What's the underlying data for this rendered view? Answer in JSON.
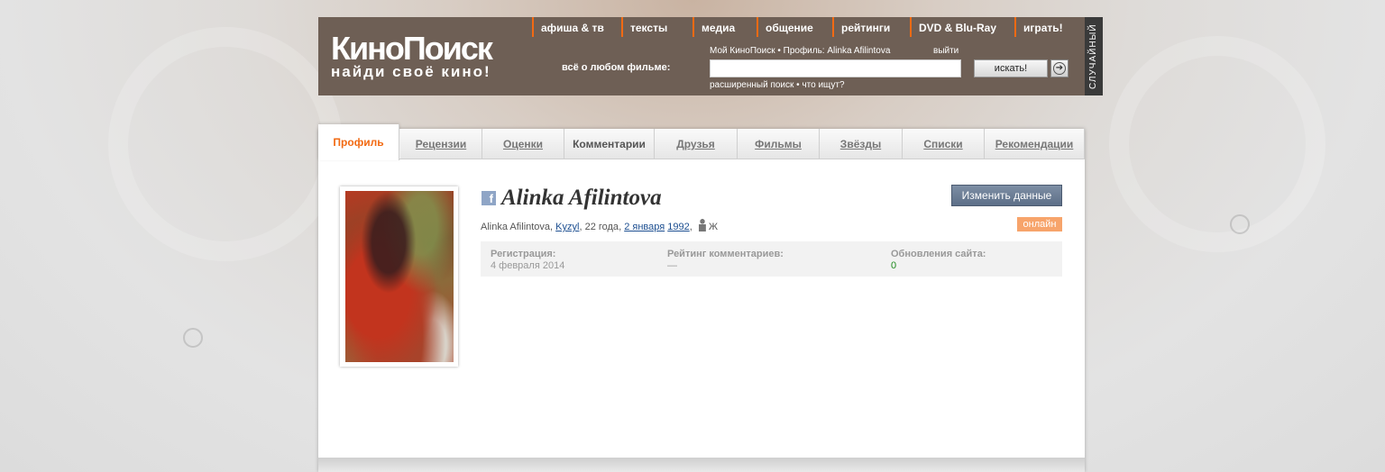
{
  "header": {
    "logo_main": "КиноПоиск",
    "logo_sub": "найди своё кино!",
    "nav": [
      "афиша & тв",
      "тексты",
      "медиа",
      "общение",
      "рейтинги",
      "DVD & Blu-Ray",
      "играть!"
    ],
    "about_label": "всё о любом фильме:",
    "user_line": "Мой КиноПоиск  •  Профиль: Alinka Afilintova",
    "logout": "выйти",
    "search_button": "искать!",
    "advanced_search": "расширенный поиск",
    "what_searched": "что ищут?",
    "random": "СЛУЧАЙНЫЙ"
  },
  "tabs": [
    "Профиль",
    "Рецензии",
    "Оценки",
    "Комментарии",
    "Друзья",
    "Фильмы",
    "Звёзды",
    "Списки",
    "Рекомендации"
  ],
  "profile": {
    "name": "Alinka Afilintova",
    "edit_button": "Изменить данные",
    "info_name": "Alinka Afilintova",
    "city": "Kyzyl",
    "age": "22 года",
    "birth_day": "2 января",
    "birth_year": "1992",
    "gender": "Ж",
    "online": "онлайн"
  },
  "stats": {
    "registration_label": "Регистрация:",
    "registration_value": "4 февраля 2014",
    "comments_rating_label": "Рейтинг комментариев:",
    "comments_rating_value": "—",
    "site_updates_label": "Обновления сайта:",
    "site_updates_value": "0"
  },
  "colors": {
    "accent": "#f26a13",
    "header_bg": "#6e5f55",
    "online_badge": "#f7a46b",
    "edit_button": "#6a7b93"
  }
}
